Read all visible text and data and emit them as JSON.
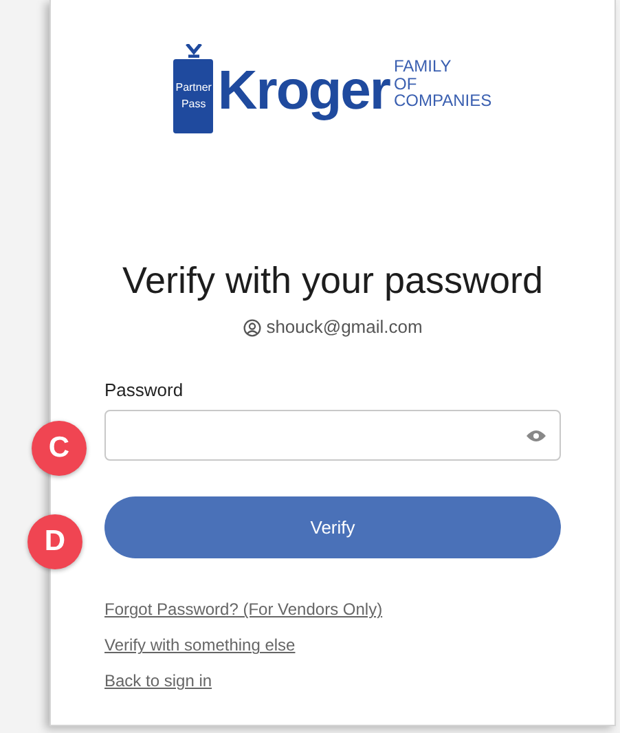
{
  "logo": {
    "badge_lines": [
      "Partner",
      "Pass"
    ],
    "wordmark": "Kroger",
    "tagline_lines": [
      "FAMILY",
      "OF",
      "COMPANIES"
    ]
  },
  "title": "Verify with your password",
  "account": "shouck@gmail.com",
  "password_field": {
    "label": "Password"
  },
  "submit_button": "Verify",
  "links": [
    "Forgot Password? (For Vendors Only)",
    "Verify with something else",
    "Back to sign in"
  ],
  "callouts": [
    "C",
    "D"
  ]
}
